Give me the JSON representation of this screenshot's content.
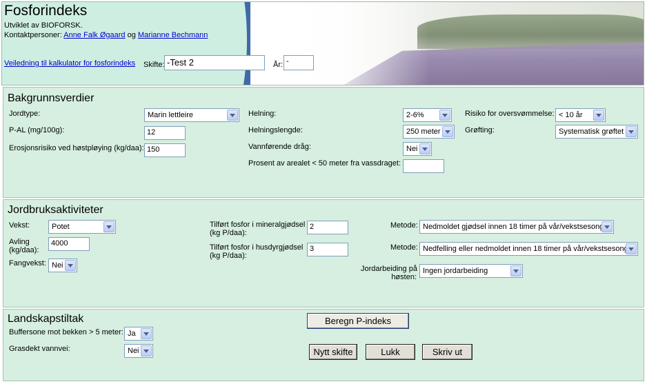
{
  "header": {
    "title": "Fosforindeks",
    "developed_by": "Utviklet av BIOFORSK.",
    "contacts_label": "Kontaktpersoner:",
    "contact_1": "Anne Falk Øgaard",
    "contacts_and": "og",
    "contact_2": "Marianne Bechmann",
    "guide_link": "Veiledning til kalkulator for fosforindeks",
    "field_label": "Skifte:",
    "field_value": "-Test 2",
    "year_label": "År:",
    "year_value": "-"
  },
  "background": {
    "title": "Bakgrunnsverdier",
    "soil_type_label": "Jordtype:",
    "soil_type_value": "Marin lettleire",
    "pal_label": "P-AL (mg/100g):",
    "pal_value": "12",
    "erosion_label": "Erosjonsrisiko ved høstpløying (kg/daa):",
    "erosion_value": "150",
    "slope_label": "Helning:",
    "slope_value": "2-6%",
    "slope_length_label": "Helningslengde:",
    "slope_length_value": "250 meter",
    "waterway_label": "Vannførende dråg:",
    "waterway_value": "Nei",
    "percent_area_label": "Prosent av arealet < 50 meter fra vassdraget:",
    "percent_area_value": "",
    "flood_risk_label": "Risiko for oversvømmelse:",
    "flood_risk_value": "< 10 år",
    "drainage_label": "Grøfting:",
    "drainage_value": "Systematisk grøftet"
  },
  "agriculture": {
    "title": "Jordbruksaktiviteter",
    "crop_label": "Vekst:",
    "crop_value": "Potet",
    "yield_label_1": "Avling",
    "yield_label_2": "(kg/daa):",
    "yield_value": "4000",
    "catch_crop_label": "Fangvekst:",
    "catch_crop_value": "Nei",
    "mineral_p_label_1": "Tilført fosfor i mineralgjødsel",
    "mineral_p_label_2": "(kg P/daa):",
    "mineral_p_value": "2",
    "manure_p_label_1": "Tilført fosfor i husdyrgjødsel",
    "manure_p_label_2": "(kg P/daa):",
    "manure_p_value": "3",
    "method_label": "Metode:",
    "method_1_value": "Nedmoldet gjødsel innen 18 timer på vår/vekstsesong",
    "method_2_value": "Nedfelling eller nedmoldet innen 18 timer på vår/vekstsesong",
    "tillage_label_1": "Jordarbeiding på",
    "tillage_label_2": "høsten:",
    "tillage_value": "Ingen jordarbeiding"
  },
  "landscape": {
    "title": "Landskapstiltak",
    "buffer_label": "Buffersone mot bekken > 5 meter:",
    "buffer_value": "Ja",
    "grassed_label": "Grasdekt vannvei:",
    "grassed_value": "Nei"
  },
  "buttons": {
    "calculate": "Beregn P-indeks",
    "new_field": "Nytt skifte",
    "close": "Lukk",
    "print": "Skriv ut"
  }
}
